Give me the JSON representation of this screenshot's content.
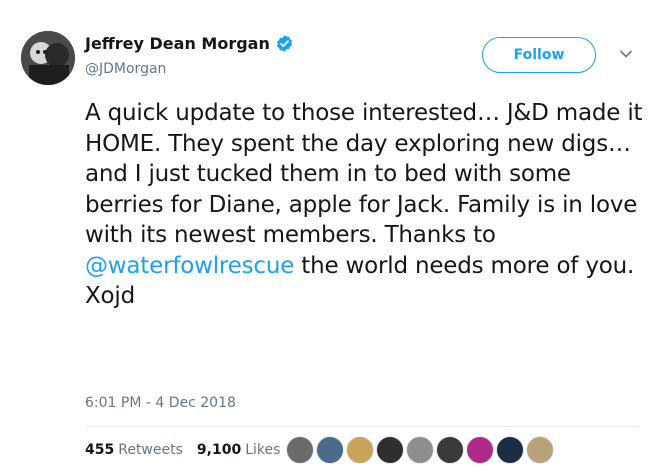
{
  "tweet": {
    "author_name": "Jeffrey Dean Morgan",
    "handle": "@JDMorgan",
    "follow_label": "Follow",
    "text_before_mention": "A quick update to those interested… J&D made it HOME. They spent the day exploring new digs… and I just tucked them in to bed with some berries for Diane, apple for Jack. Family is in love with its newest members. Thanks to ",
    "mention": "@waterfowlrescue",
    "text_after_mention": " the world needs more of you. Xojd",
    "timestamp": "6:01 PM - 4 Dec 2018",
    "retweets_count": "455",
    "retweets_label": "Retweets",
    "likes_count": "9,100",
    "likes_label": "Likes"
  },
  "colors": {
    "accent": "#1da1f2",
    "text": "#14171a",
    "secondary": "#657786"
  },
  "liker_avatars": [
    {
      "color": "#6b6b6b"
    },
    {
      "color": "#4a6b8a"
    },
    {
      "color": "#c9a35a"
    },
    {
      "color": "#2f2f2f"
    },
    {
      "color": "#8e8e8e"
    },
    {
      "color": "#3a3a3a"
    },
    {
      "color": "#b02a8a"
    },
    {
      "color": "#1e2d46"
    },
    {
      "color": "#b9a27a"
    }
  ]
}
